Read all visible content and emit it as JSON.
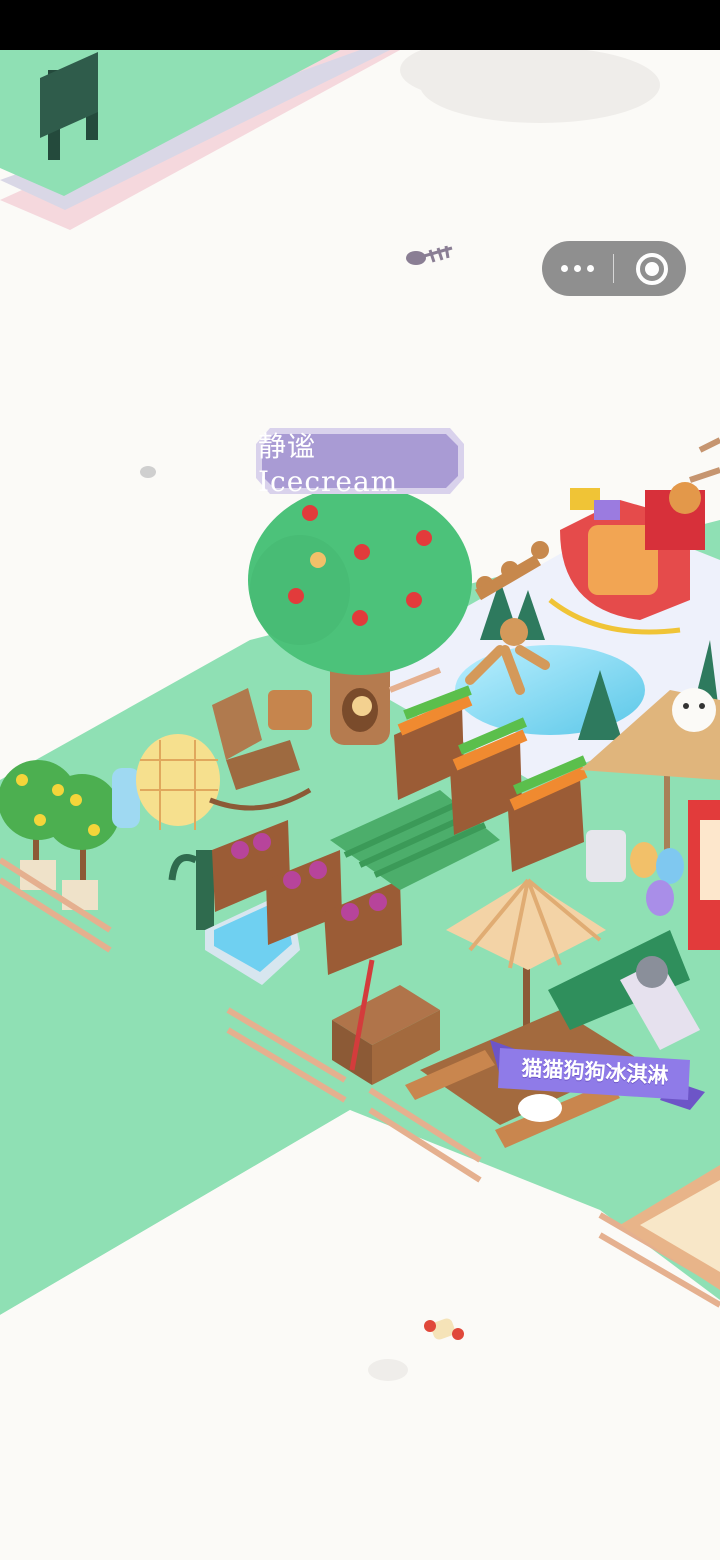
{
  "game": {
    "player_name_label": "静谧 Icecream",
    "shop_name_label": "猫猫狗狗冰淇淋"
  },
  "mini_program_capsule": {
    "more_icon": "more-dots-icon",
    "close_icon": "close-target-icon"
  },
  "colors": {
    "grass": "#8fe0b4",
    "background": "#fbfaf7",
    "label_purple": "#a99bd4",
    "banner_purple": "#8f7be8",
    "capsule_gray": "#8a8a8a"
  }
}
